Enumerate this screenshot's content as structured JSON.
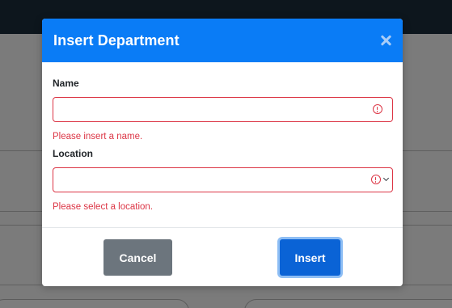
{
  "dialog": {
    "title": "Insert Department",
    "close_icon": "close-icon"
  },
  "form": {
    "name": {
      "label": "Name",
      "value": "",
      "error": "Please insert a name.",
      "icon": "error-icon"
    },
    "location": {
      "label": "Location",
      "value": "",
      "error": "Please select a location.",
      "icon": "error-icon"
    }
  },
  "buttons": {
    "cancel": "Cancel",
    "insert": "Insert"
  },
  "colors": {
    "header": "#0a7cf6",
    "error": "#dc3545",
    "cancel": "#6c757d",
    "insert": "#0a63d6"
  }
}
